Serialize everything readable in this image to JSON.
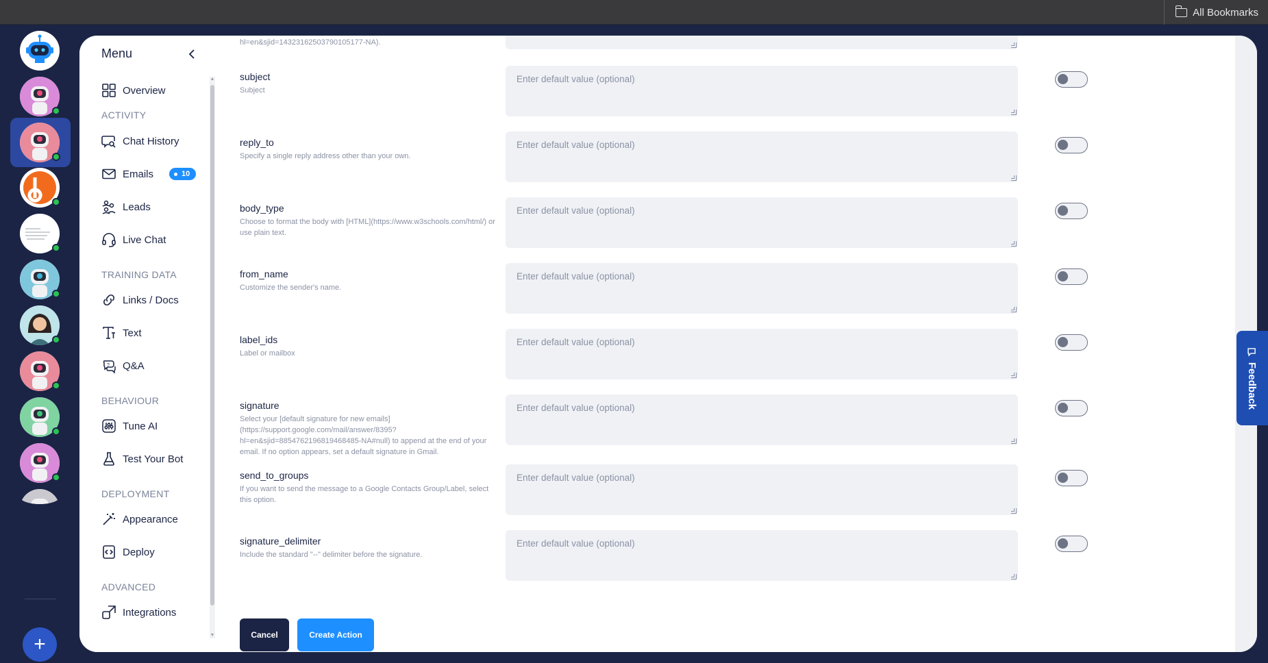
{
  "browser": {
    "bookmarks_label": "All Bookmarks"
  },
  "menu": {
    "title": "Menu",
    "items": [
      {
        "id": "overview",
        "label": "Overview"
      },
      {
        "id": "chat-history",
        "label": "Chat History"
      },
      {
        "id": "emails",
        "label": "Emails",
        "badge": "10"
      },
      {
        "id": "leads",
        "label": "Leads"
      },
      {
        "id": "live-chat",
        "label": "Live Chat"
      },
      {
        "id": "links-docs",
        "label": "Links / Docs"
      },
      {
        "id": "text",
        "label": "Text"
      },
      {
        "id": "qa",
        "label": "Q&A"
      },
      {
        "id": "tune-ai",
        "label": "Tune AI"
      },
      {
        "id": "test-your-bot",
        "label": "Test Your Bot"
      },
      {
        "id": "appearance",
        "label": "Appearance"
      },
      {
        "id": "deploy",
        "label": "Deploy"
      },
      {
        "id": "integrations",
        "label": "Integrations"
      }
    ],
    "sections": {
      "activity": "ACTIVITY",
      "training_data": "TRAINING DATA",
      "behaviour": "BEHAVIOUR",
      "deployment": "DEPLOYMENT",
      "advanced": "ADVANCED"
    }
  },
  "form": {
    "top_fragment": "hl=en&sjid=14323162503790105177-NA).",
    "placeholder": "Enter default value (optional)",
    "params": [
      {
        "name": "subject",
        "desc": "Subject"
      },
      {
        "name": "reply_to",
        "desc": "Specify a single reply address other than your own."
      },
      {
        "name": "body_type",
        "desc": "Choose to format the body with [HTML](https://www.w3schools.com/html/) or use plain text."
      },
      {
        "name": "from_name",
        "desc": "Customize the sender's name."
      },
      {
        "name": "label_ids",
        "desc": "Label or mailbox"
      },
      {
        "name": "signature",
        "desc": "Select your [default signature for new emails](https://support.google.com/mail/answer/8395?hl=en&sjid=8854762196819468485-NA#null) to append at the end of your email. If no option appears, set a default signature in Gmail."
      },
      {
        "name": "send_to_groups",
        "desc": "If you want to send the message to a Google Contacts Group/Label, select this option."
      },
      {
        "name": "signature_delimiter",
        "desc": "Include the standard \"--\" delimiter before the signature."
      }
    ],
    "toggles_on": [
      false,
      false,
      false,
      false,
      false,
      false,
      false,
      false
    ]
  },
  "actions": {
    "cancel": "Cancel",
    "create": "Create Action"
  },
  "feedback": {
    "label": "Feedback"
  },
  "colors": {
    "navy": "#1b2444",
    "accent": "#1e8fff",
    "online": "#2bc253"
  }
}
